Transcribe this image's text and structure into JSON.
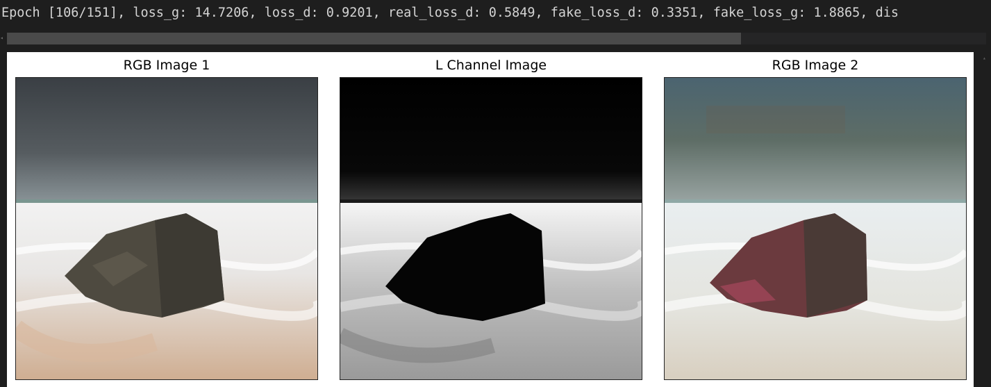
{
  "output": {
    "log_line": "Epoch [106/151], loss_g: 14.7206, loss_d: 0.9201, real_loss_d: 0.5849, fake_loss_d: 0.3351, fake_loss_g: 1.8865, dis"
  },
  "figure": {
    "panels": [
      {
        "title": "RGB Image 1"
      },
      {
        "title": "L Channel Image"
      },
      {
        "title": "RGB Image 2"
      }
    ]
  }
}
